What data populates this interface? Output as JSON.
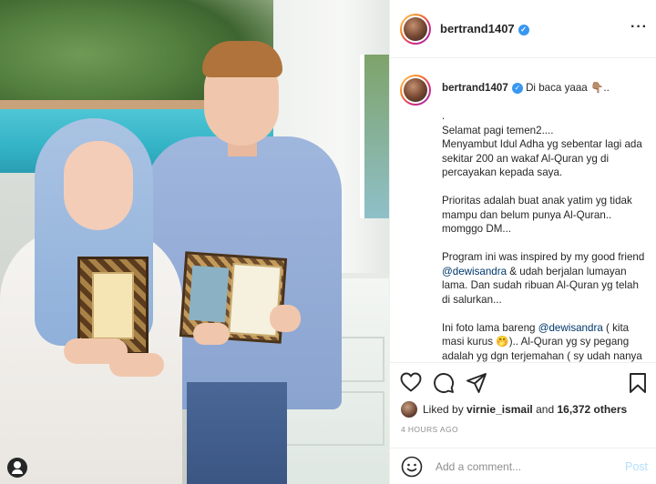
{
  "post": {
    "username": "bertrand1407",
    "caption_first_line": "Di baca yaaa 👇🏽..",
    "caption_segments": [
      {
        "text": ".\nSelamat pagi temen2....\nMenyambut Idul Adha yg sebentar lagi ada sekitar 200 an wakaf Al-Quran yg di percayakan kepada saya.\n\nPrioritas adalah buat anak yatim yg tidak mampu dan belum punya Al-Quran.. momggo DM...\n\nProgram ini was inspired by my good friend ",
        "mention": false
      },
      {
        "text": "@dewisandra",
        "mention": true
      },
      {
        "text": " & udah berjalan lumayan lama. Dan sudah ribuan Al-Quran yg telah di salurkan...\n\nIni foto lama bareng ",
        "mention": false
      },
      {
        "text": "@dewisandra",
        "mention": true
      },
      {
        "text": " ( kita masi kurus 🤭).. Al-Quran yg sy pegang adalah yg dgn terjemahan ( sy udah nanya boleh sy pegang",
        "mention": false
      }
    ],
    "liked_by_prefix": "Liked by ",
    "liked_by_user": "virnie_ismail",
    "liked_by_mid": " and ",
    "liked_by_count": "16,372 others",
    "timestamp": "4 HOURS AGO"
  },
  "comment": {
    "placeholder": "Add a comment...",
    "post_label": "Post"
  },
  "icons": {
    "verified": "verified-badge-icon",
    "more": "more-options-icon",
    "like": "heart-icon",
    "comment": "comment-bubble-icon",
    "share": "paper-plane-icon",
    "save": "bookmark-icon",
    "emoji": "smiley-icon",
    "tag": "user-tag-icon"
  },
  "colors": {
    "verified_blue": "#3897f0",
    "mention": "#00376b",
    "post_disabled": "#b2dffc",
    "muted": "#8e8e8e"
  }
}
